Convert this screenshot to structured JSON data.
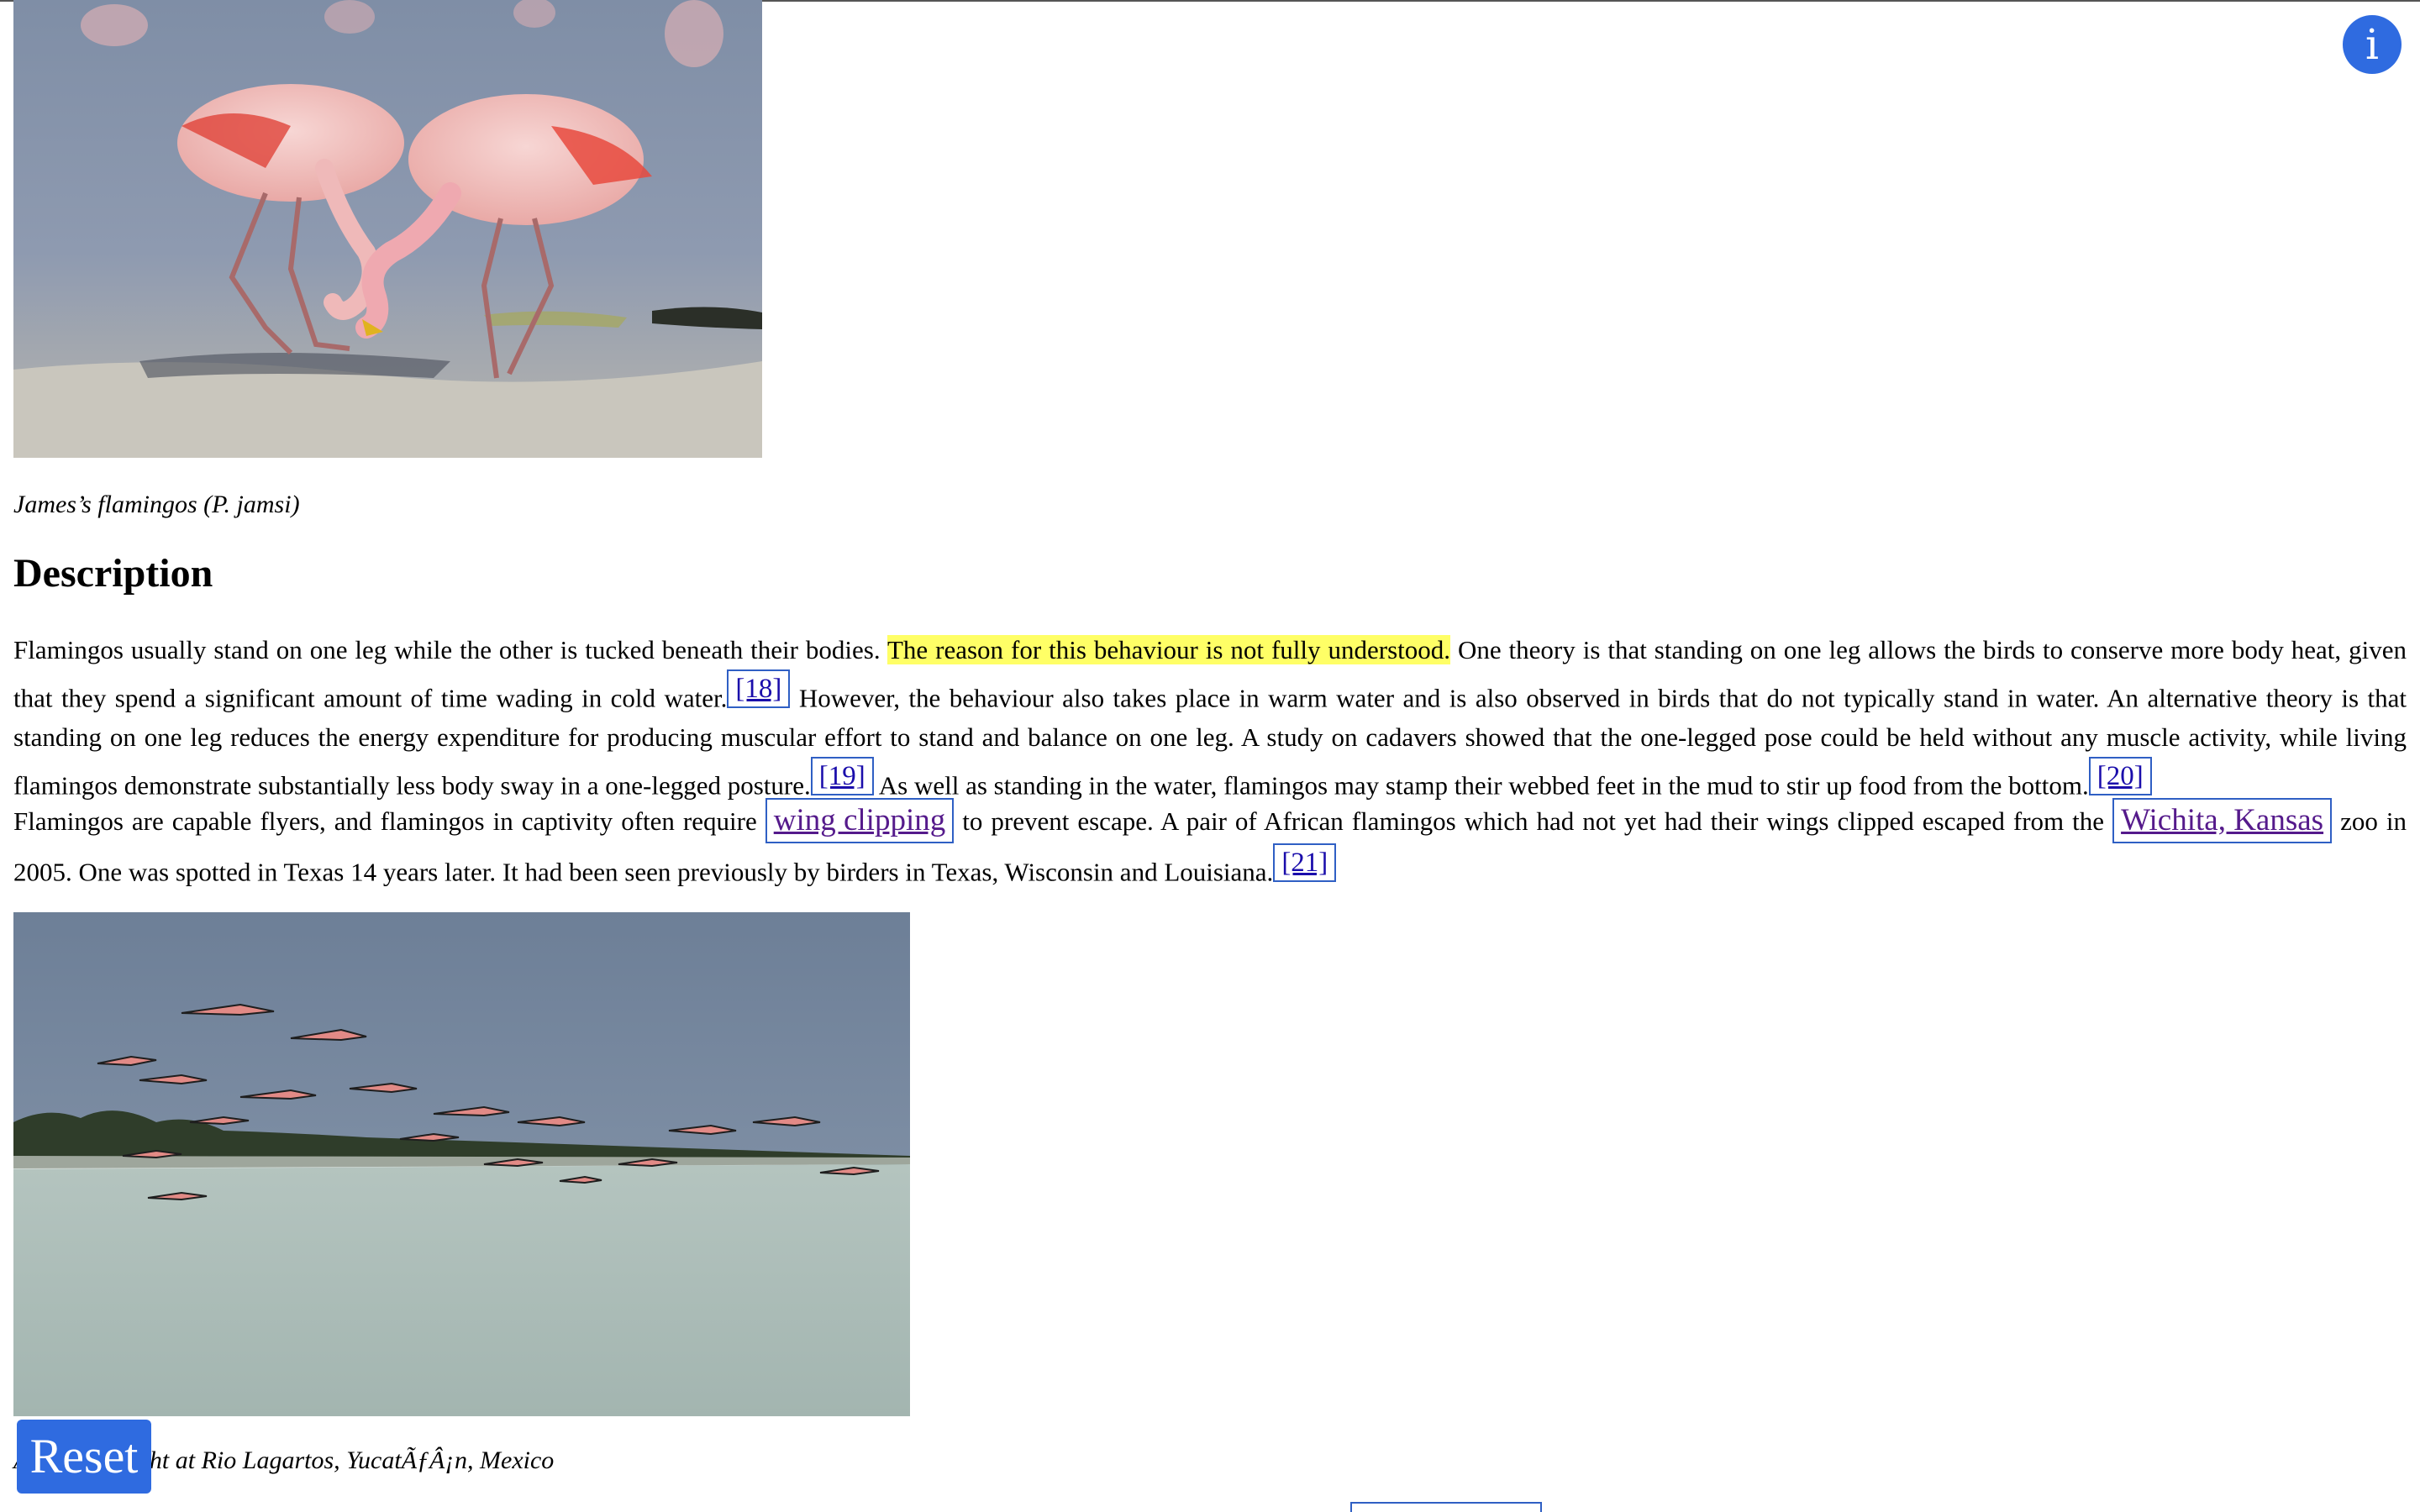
{
  "figure1": {
    "image_alt": "James's flamingos feeding in shallow water",
    "caption": "James’s flamingos (P. jamsi)"
  },
  "section": {
    "heading": "Description"
  },
  "paragraph1": {
    "text_a": "Flamingos usually stand on one leg while the other is tucked beneath their bodies. ",
    "highlight": "The reason for this behaviour is not fully understood.",
    "text_b": " One theory is that standing on one leg allows the birds to conserve more body heat, given that they spend a significant amount of time wading in cold water.",
    "ref1": "[18]",
    "text_c": " However, the behaviour also takes place in warm water and is also observed in birds that do not typically stand in water. An alternative theory is that standing on one leg reduces the energy expenditure for producing muscular effort to stand and balance on one leg. A study on cadavers showed that the one-legged pose could be held without any muscle activity, while living flamingos demonstrate substantially less body sway in a one-legged posture.",
    "ref2": "[19]",
    "text_d": " As well as standing in the water, flamingos may stamp their webbed feet in the mud to stir up food from the bottom.",
    "ref3": "[20]"
  },
  "paragraph2": {
    "text_a": "Flamingos are capable flyers, and flamingos in captivity often require ",
    "link1": "wing clipping",
    "text_b": " to prevent escape. A pair of African flamingos which had not yet had their wings clipped escaped from the ",
    "link2": "Wichita, Kansas",
    "text_c": " zoo in 2005. One was spotted in Texas 14 years later. It had been seen previously by birders in Texas, Wisconsin and Louisiana.",
    "ref1": "[21]"
  },
  "figure2": {
    "image_alt": "Flamingos in flight",
    "caption": "A flock in flight at Rio Lagartos, YucatÃƒÂ¡n, Mexico"
  },
  "controls": {
    "info_label": "i",
    "reset_label": "Reset"
  },
  "colors": {
    "accent": "#2f6be0",
    "highlight": "#ffff66",
    "link_border": "#2f5fc4"
  }
}
